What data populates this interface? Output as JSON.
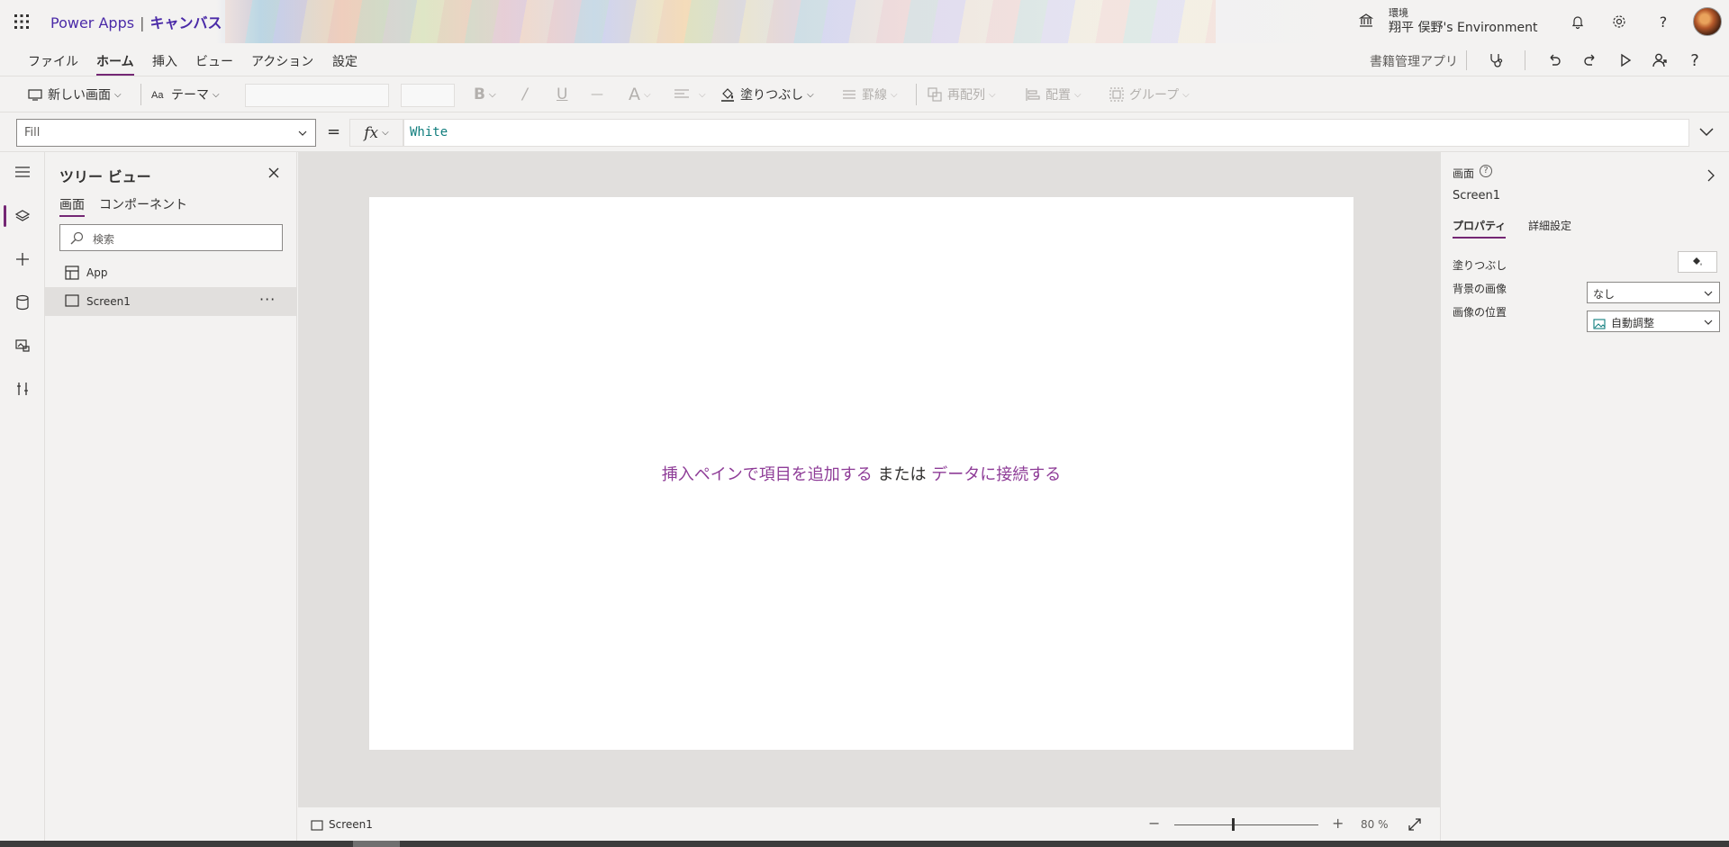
{
  "header": {
    "product": "Power Apps",
    "separator": "|",
    "mode": "キャンバス",
    "environment_label": "環境",
    "environment_name": "翔平 俣野's Environment"
  },
  "menubar": {
    "items": [
      {
        "label": "ファイル"
      },
      {
        "label": "ホーム",
        "active": true
      },
      {
        "label": "挿入"
      },
      {
        "label": "ビュー"
      },
      {
        "label": "アクション"
      },
      {
        "label": "設定"
      }
    ],
    "app_name": "書籍管理アプリ"
  },
  "toolbar": {
    "new_screen": "新しい画面",
    "theme": "テーマ",
    "bold": "B",
    "italic": "/",
    "underline": "U",
    "strikethrough": "—",
    "font_color": "A",
    "fill": "塗りつぶし",
    "border": "罫線",
    "reorder": "再配列",
    "align": "配置",
    "group": "グループ"
  },
  "formula": {
    "property": "Fill",
    "equals": "=",
    "fx": "fx",
    "value": "White"
  },
  "tree": {
    "title": "ツリー ビュー",
    "tabs": [
      {
        "label": "画面",
        "active": true
      },
      {
        "label": "コンポーネント"
      }
    ],
    "search_placeholder": "検索",
    "items": [
      {
        "label": "App"
      },
      {
        "label": "Screen1",
        "selected": true,
        "more": "···"
      }
    ]
  },
  "canvas": {
    "hint_link1": "挿入ペインで項目を追加する",
    "hint_middle": " または ",
    "hint_link2": "データに接続する"
  },
  "bottombar": {
    "screen": "Screen1",
    "zoom_minus": "−",
    "zoom_plus": "+",
    "zoom_value": "80 %",
    "zoom_level": 0.4
  },
  "properties": {
    "type": "画面",
    "name": "Screen1",
    "tabs": [
      {
        "label": "プロパティ",
        "active": true
      },
      {
        "label": "詳細設定"
      }
    ],
    "fill_label": "塗りつぶし",
    "bg_image_label": "背景の画像",
    "bg_image_value": "なし",
    "image_position_label": "画像の位置",
    "image_position_value": "自動調整"
  },
  "colors": {
    "accent": "#742774",
    "title_purple": "#4b2ba8",
    "hint_link": "#8e3c97",
    "formula_text": "#0f7d7d"
  }
}
